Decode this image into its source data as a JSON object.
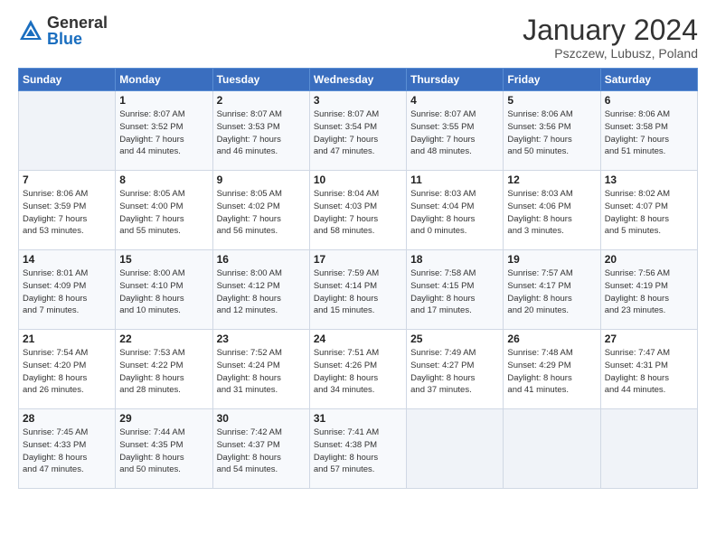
{
  "header": {
    "logo_general": "General",
    "logo_blue": "Blue",
    "month_year": "January 2024",
    "location": "Pszczew, Lubusz, Poland"
  },
  "weekdays": [
    "Sunday",
    "Monday",
    "Tuesday",
    "Wednesday",
    "Thursday",
    "Friday",
    "Saturday"
  ],
  "weeks": [
    [
      {
        "day": "",
        "info": ""
      },
      {
        "day": "1",
        "info": "Sunrise: 8:07 AM\nSunset: 3:52 PM\nDaylight: 7 hours\nand 44 minutes."
      },
      {
        "day": "2",
        "info": "Sunrise: 8:07 AM\nSunset: 3:53 PM\nDaylight: 7 hours\nand 46 minutes."
      },
      {
        "day": "3",
        "info": "Sunrise: 8:07 AM\nSunset: 3:54 PM\nDaylight: 7 hours\nand 47 minutes."
      },
      {
        "day": "4",
        "info": "Sunrise: 8:07 AM\nSunset: 3:55 PM\nDaylight: 7 hours\nand 48 minutes."
      },
      {
        "day": "5",
        "info": "Sunrise: 8:06 AM\nSunset: 3:56 PM\nDaylight: 7 hours\nand 50 minutes."
      },
      {
        "day": "6",
        "info": "Sunrise: 8:06 AM\nSunset: 3:58 PM\nDaylight: 7 hours\nand 51 minutes."
      }
    ],
    [
      {
        "day": "7",
        "info": "Sunrise: 8:06 AM\nSunset: 3:59 PM\nDaylight: 7 hours\nand 53 minutes."
      },
      {
        "day": "8",
        "info": "Sunrise: 8:05 AM\nSunset: 4:00 PM\nDaylight: 7 hours\nand 55 minutes."
      },
      {
        "day": "9",
        "info": "Sunrise: 8:05 AM\nSunset: 4:02 PM\nDaylight: 7 hours\nand 56 minutes."
      },
      {
        "day": "10",
        "info": "Sunrise: 8:04 AM\nSunset: 4:03 PM\nDaylight: 7 hours\nand 58 minutes."
      },
      {
        "day": "11",
        "info": "Sunrise: 8:03 AM\nSunset: 4:04 PM\nDaylight: 8 hours\nand 0 minutes."
      },
      {
        "day": "12",
        "info": "Sunrise: 8:03 AM\nSunset: 4:06 PM\nDaylight: 8 hours\nand 3 minutes."
      },
      {
        "day": "13",
        "info": "Sunrise: 8:02 AM\nSunset: 4:07 PM\nDaylight: 8 hours\nand 5 minutes."
      }
    ],
    [
      {
        "day": "14",
        "info": "Sunrise: 8:01 AM\nSunset: 4:09 PM\nDaylight: 8 hours\nand 7 minutes."
      },
      {
        "day": "15",
        "info": "Sunrise: 8:00 AM\nSunset: 4:10 PM\nDaylight: 8 hours\nand 10 minutes."
      },
      {
        "day": "16",
        "info": "Sunrise: 8:00 AM\nSunset: 4:12 PM\nDaylight: 8 hours\nand 12 minutes."
      },
      {
        "day": "17",
        "info": "Sunrise: 7:59 AM\nSunset: 4:14 PM\nDaylight: 8 hours\nand 15 minutes."
      },
      {
        "day": "18",
        "info": "Sunrise: 7:58 AM\nSunset: 4:15 PM\nDaylight: 8 hours\nand 17 minutes."
      },
      {
        "day": "19",
        "info": "Sunrise: 7:57 AM\nSunset: 4:17 PM\nDaylight: 8 hours\nand 20 minutes."
      },
      {
        "day": "20",
        "info": "Sunrise: 7:56 AM\nSunset: 4:19 PM\nDaylight: 8 hours\nand 23 minutes."
      }
    ],
    [
      {
        "day": "21",
        "info": "Sunrise: 7:54 AM\nSunset: 4:20 PM\nDaylight: 8 hours\nand 26 minutes."
      },
      {
        "day": "22",
        "info": "Sunrise: 7:53 AM\nSunset: 4:22 PM\nDaylight: 8 hours\nand 28 minutes."
      },
      {
        "day": "23",
        "info": "Sunrise: 7:52 AM\nSunset: 4:24 PM\nDaylight: 8 hours\nand 31 minutes."
      },
      {
        "day": "24",
        "info": "Sunrise: 7:51 AM\nSunset: 4:26 PM\nDaylight: 8 hours\nand 34 minutes."
      },
      {
        "day": "25",
        "info": "Sunrise: 7:49 AM\nSunset: 4:27 PM\nDaylight: 8 hours\nand 37 minutes."
      },
      {
        "day": "26",
        "info": "Sunrise: 7:48 AM\nSunset: 4:29 PM\nDaylight: 8 hours\nand 41 minutes."
      },
      {
        "day": "27",
        "info": "Sunrise: 7:47 AM\nSunset: 4:31 PM\nDaylight: 8 hours\nand 44 minutes."
      }
    ],
    [
      {
        "day": "28",
        "info": "Sunrise: 7:45 AM\nSunset: 4:33 PM\nDaylight: 8 hours\nand 47 minutes."
      },
      {
        "day": "29",
        "info": "Sunrise: 7:44 AM\nSunset: 4:35 PM\nDaylight: 8 hours\nand 50 minutes."
      },
      {
        "day": "30",
        "info": "Sunrise: 7:42 AM\nSunset: 4:37 PM\nDaylight: 8 hours\nand 54 minutes."
      },
      {
        "day": "31",
        "info": "Sunrise: 7:41 AM\nSunset: 4:38 PM\nDaylight: 8 hours\nand 57 minutes."
      },
      {
        "day": "",
        "info": ""
      },
      {
        "day": "",
        "info": ""
      },
      {
        "day": "",
        "info": ""
      }
    ]
  ]
}
